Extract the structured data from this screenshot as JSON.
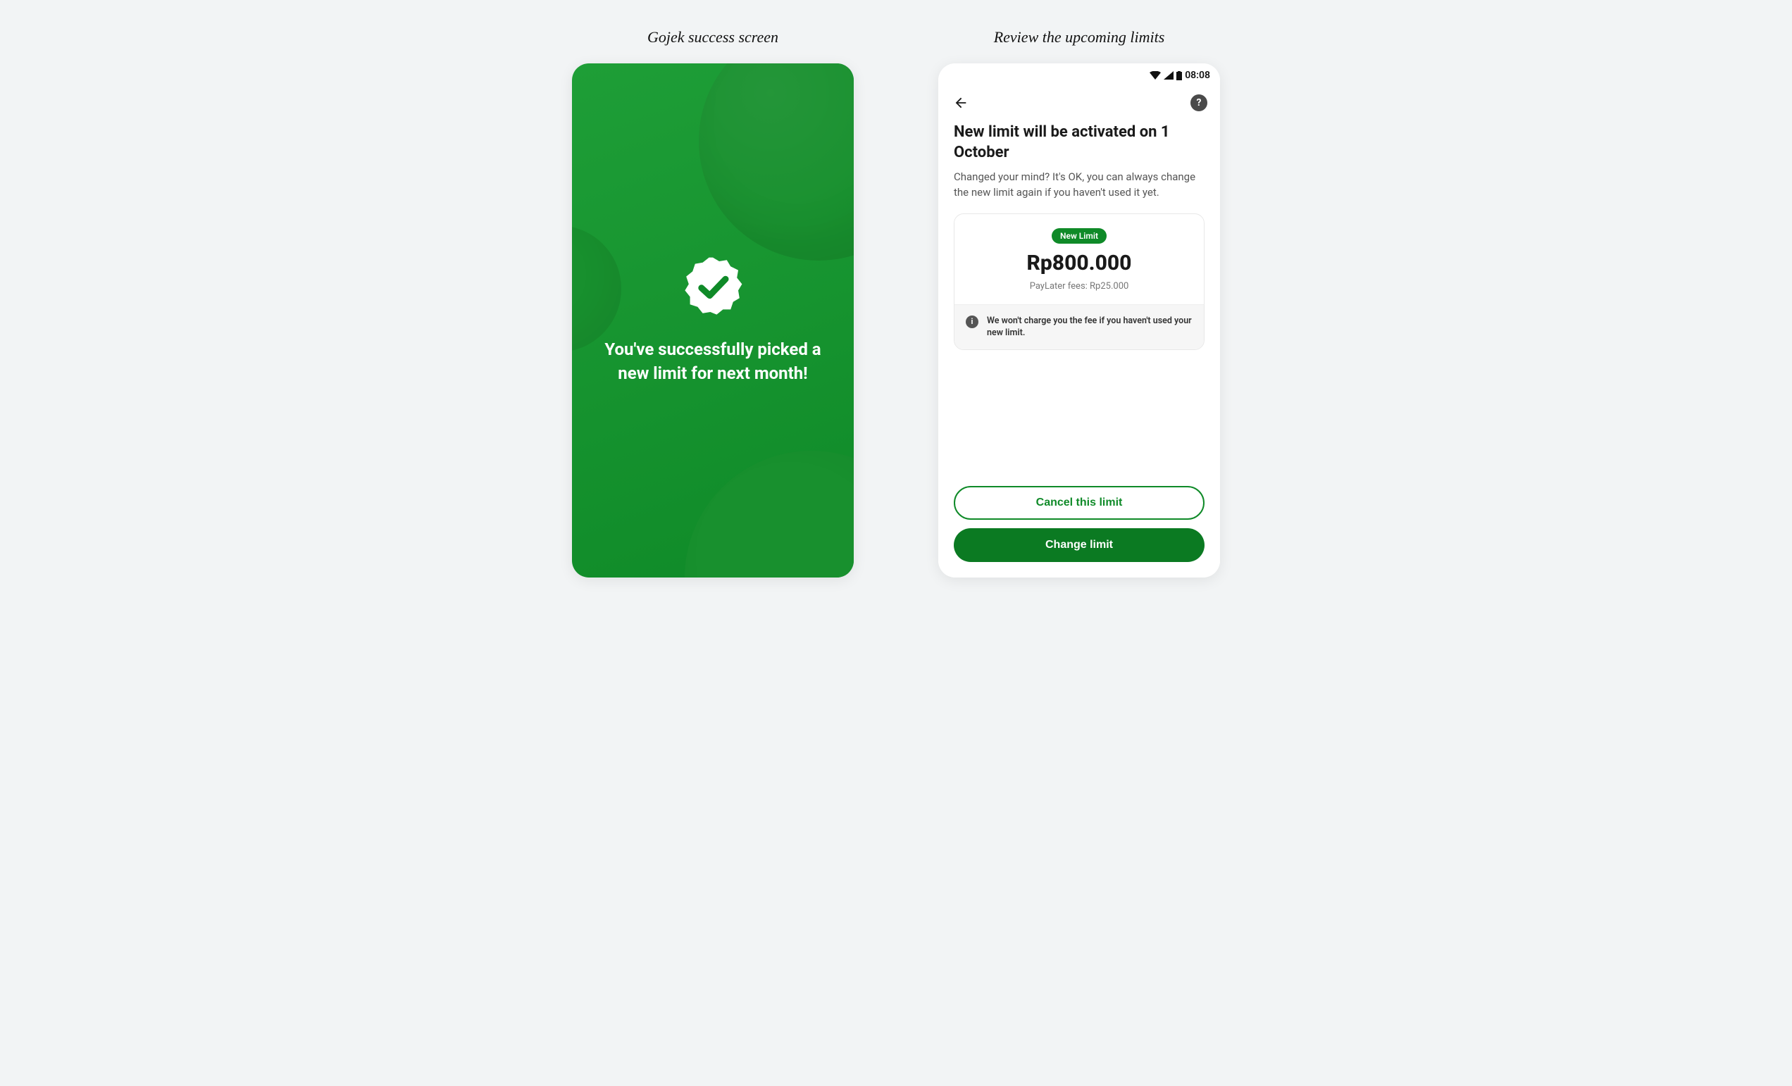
{
  "captions": {
    "left": "Gojek success screen",
    "right": "Review the upcoming limits"
  },
  "success": {
    "message": "You've successfully picked a new limit for next month!"
  },
  "review": {
    "status_time": "08:08",
    "title": "New limit will be activated on 1 October",
    "subtitle": "Changed your mind? It's OK, you can always change the new limit again if you haven't used it yet.",
    "card": {
      "pill": "New Limit",
      "amount": "Rp800.000",
      "fee": "PayLater fees: Rp25.000",
      "note": "We won't charge you the fee if you haven't used your new limit."
    },
    "actions": {
      "cancel": "Cancel this limit",
      "change": "Change limit"
    }
  }
}
